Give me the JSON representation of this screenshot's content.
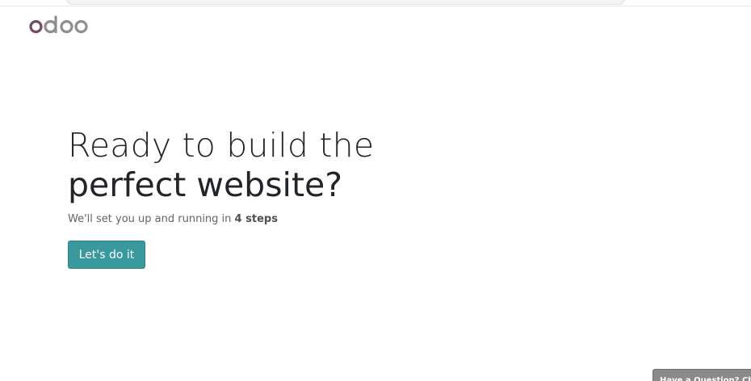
{
  "logo": {
    "icon": "odoo-logo",
    "text": "odoo",
    "colors": {
      "o1": "#714B67",
      "rest": "#8F8F8F"
    }
  },
  "hero": {
    "headline_line1": "Ready to build the",
    "headline_line2": "perfect website?",
    "subtitle_prefix": "We'll set you up and running in ",
    "subtitle_emphasis": "4 steps"
  },
  "cta": {
    "label": "Let's do it",
    "color": "#3A999E"
  },
  "livechat": {
    "label": "Have a Question? Chat with us."
  }
}
